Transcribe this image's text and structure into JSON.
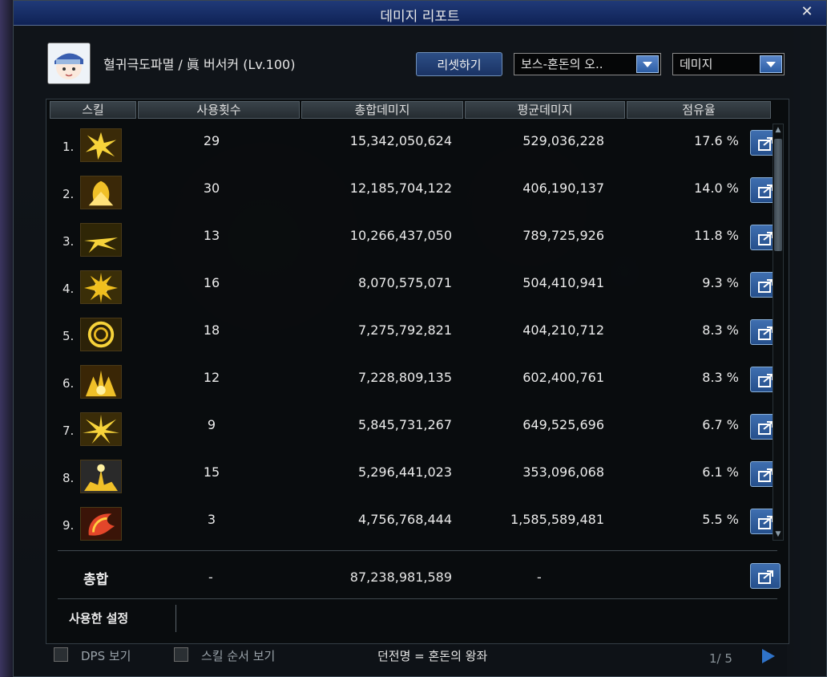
{
  "window": {
    "title": "데미지 리포트",
    "close_label": "✕"
  },
  "character": {
    "name_line": "혈귀극도파멸 / 眞 버서커 (Lv.100)"
  },
  "controls": {
    "reset_label": "리셋하기",
    "boss_select": "보스-혼돈의 오..",
    "metric_select": "데미지"
  },
  "table": {
    "headers": [
      "스킬",
      "사용횟수",
      "총합데미지",
      "평균데미지",
      "점유율"
    ],
    "rows": [
      {
        "index": "1.",
        "uses": "29",
        "total": "15,342,050,624",
        "avg": "529,036,228",
        "pct": "17.6 %"
      },
      {
        "index": "2.",
        "uses": "30",
        "total": "12,185,704,122",
        "avg": "406,190,137",
        "pct": "14.0 %"
      },
      {
        "index": "3.",
        "uses": "13",
        "total": "10,266,437,050",
        "avg": "789,725,926",
        "pct": "11.8 %"
      },
      {
        "index": "4.",
        "uses": "16",
        "total": "8,070,575,071",
        "avg": "504,410,941",
        "pct": "9.3 %"
      },
      {
        "index": "5.",
        "uses": "18",
        "total": "7,275,792,821",
        "avg": "404,210,712",
        "pct": "8.3 %"
      },
      {
        "index": "6.",
        "uses": "12",
        "total": "7,228,809,135",
        "avg": "602,400,761",
        "pct": "8.3 %"
      },
      {
        "index": "7.",
        "uses": "9",
        "total": "5,845,731,267",
        "avg": "649,525,696",
        "pct": "6.7 %"
      },
      {
        "index": "8.",
        "uses": "15",
        "total": "5,296,441,023",
        "avg": "353,096,068",
        "pct": "6.1 %"
      },
      {
        "index": "9.",
        "uses": "3",
        "total": "4,756,768,444",
        "avg": "1,585,589,481",
        "pct": "5.5 %"
      }
    ],
    "summary": {
      "label": "총합",
      "uses": "-",
      "total": "87,238,981,589",
      "avg": "-"
    },
    "used_setting_label": "사용한 설정"
  },
  "footer": {
    "dps_label": "DPS 보기",
    "skill_order_label": "스킬 순서 보기",
    "dungeon_label": "던전명 = 혼돈의 왕좌",
    "page": "1/ 5"
  },
  "colors": {
    "title_bar": "#1a3470",
    "accent_blue": "#2f6bb5",
    "skill_gold": "#f2c200"
  }
}
